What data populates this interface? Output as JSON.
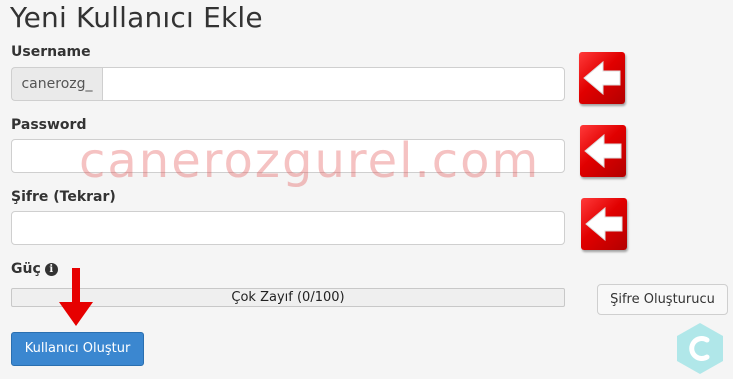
{
  "title": "Yeni Kullanıcı Ekle",
  "username": {
    "label": "Username",
    "prefix": "canerozg_",
    "value": ""
  },
  "password": {
    "label": "Password",
    "value": ""
  },
  "password_repeat": {
    "label": "Şifre (Tekrar)",
    "value": ""
  },
  "strength": {
    "label": "Güç",
    "info_icon": "info-icon",
    "text": "Çok Zayıf (0/100)",
    "value": 0,
    "max": 100
  },
  "generator_button": "Şifre Oluşturucu",
  "submit_button": "Kullanıcı Oluştur",
  "watermark": "canerozgurel.com",
  "colors": {
    "primary_button": "#3b87d0",
    "arrow_red": "#e10000",
    "watermark": "#e25050",
    "logo_teal": "#9ee5e6"
  }
}
